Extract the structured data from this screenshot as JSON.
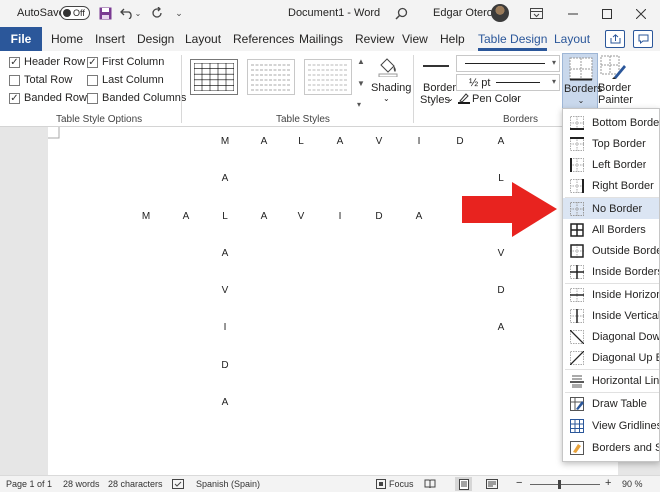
{
  "titlebar": {
    "autosave_label": "AutoSave",
    "toggle_state": "Off",
    "document_title": "Document1 - Word",
    "user_name": "Edgar Otero"
  },
  "tabs": {
    "file": "File",
    "items": [
      "Home",
      "Insert",
      "Design",
      "Layout",
      "References",
      "Mailings",
      "Review",
      "View",
      "Help",
      "Table Design",
      "Layout"
    ],
    "active": "Table Design"
  },
  "ribbon": {
    "table_style_options": {
      "label": "Table Style Options",
      "checkboxes": [
        {
          "label": "Header Row",
          "checked": true
        },
        {
          "label": "First Column",
          "checked": true
        },
        {
          "label": "Total Row",
          "checked": false
        },
        {
          "label": "Last Column",
          "checked": false
        },
        {
          "label": "Banded Rows",
          "checked": true
        },
        {
          "label": "Banded Columns",
          "checked": false
        }
      ]
    },
    "table_styles": {
      "label": "Table Styles",
      "shading_label": "Shading"
    },
    "borders_group": {
      "label": "Borders",
      "border_styles_line1": "Border",
      "border_styles_line2": "Styles",
      "weight": "½ pt",
      "pen_color": "Pen Color",
      "borders_button": "Borders",
      "painter_line1": "Border",
      "painter_line2": "Painter"
    }
  },
  "document": {
    "row_top": [
      "M",
      "A",
      "L",
      "A",
      "V",
      "I",
      "D",
      "A"
    ],
    "row_middle": [
      "M",
      "A",
      "L",
      "A",
      "V",
      "I",
      "D",
      "A"
    ],
    "col_left": [
      "M",
      "A",
      "L",
      "A",
      "V",
      "I",
      "D",
      "A"
    ],
    "col_right": [
      "A",
      "L",
      "A",
      "V",
      "D",
      "A"
    ]
  },
  "borders_menu": {
    "items": [
      {
        "label": "Bottom Border",
        "icon": "bottom-border-icon"
      },
      {
        "label": "Top Border",
        "icon": "top-border-icon"
      },
      {
        "label": "Left Border",
        "icon": "left-border-icon"
      },
      {
        "label": "Right Border",
        "icon": "right-border-icon"
      },
      {
        "label": "No Border",
        "icon": "no-border-icon",
        "highlighted": true
      },
      {
        "label": "All Borders",
        "icon": "all-borders-icon"
      },
      {
        "label": "Outside Borders",
        "icon": "outside-borders-icon"
      },
      {
        "label": "Inside Borders",
        "icon": "inside-borders-icon"
      },
      {
        "label": "Inside Horizontal Border",
        "icon": "inside-horizontal-border-icon"
      },
      {
        "label": "Inside Vertical Border",
        "icon": "inside-vertical-border-icon"
      },
      {
        "label": "Diagonal Down Border",
        "icon": "diagonal-down-border-icon"
      },
      {
        "label": "Diagonal Up Border",
        "icon": "diagonal-up-border-icon"
      },
      {
        "label": "Horizontal Line",
        "icon": "horizontal-line-icon"
      },
      {
        "label": "Draw Table",
        "icon": "draw-table-icon"
      },
      {
        "label": "View Gridlines",
        "icon": "view-gridlines-icon"
      },
      {
        "label": "Borders and Shading...",
        "icon": "borders-and-shading-icon"
      }
    ]
  },
  "statusbar": {
    "page": "Page 1 of 1",
    "words": "28 words",
    "characters": "28 characters",
    "language": "Spanish (Spain)",
    "focus": "Focus",
    "zoom": "90 %"
  },
  "colors": {
    "accent": "#2b579a",
    "arrow": "#e8231f",
    "highlight": "#dbe5f3"
  }
}
